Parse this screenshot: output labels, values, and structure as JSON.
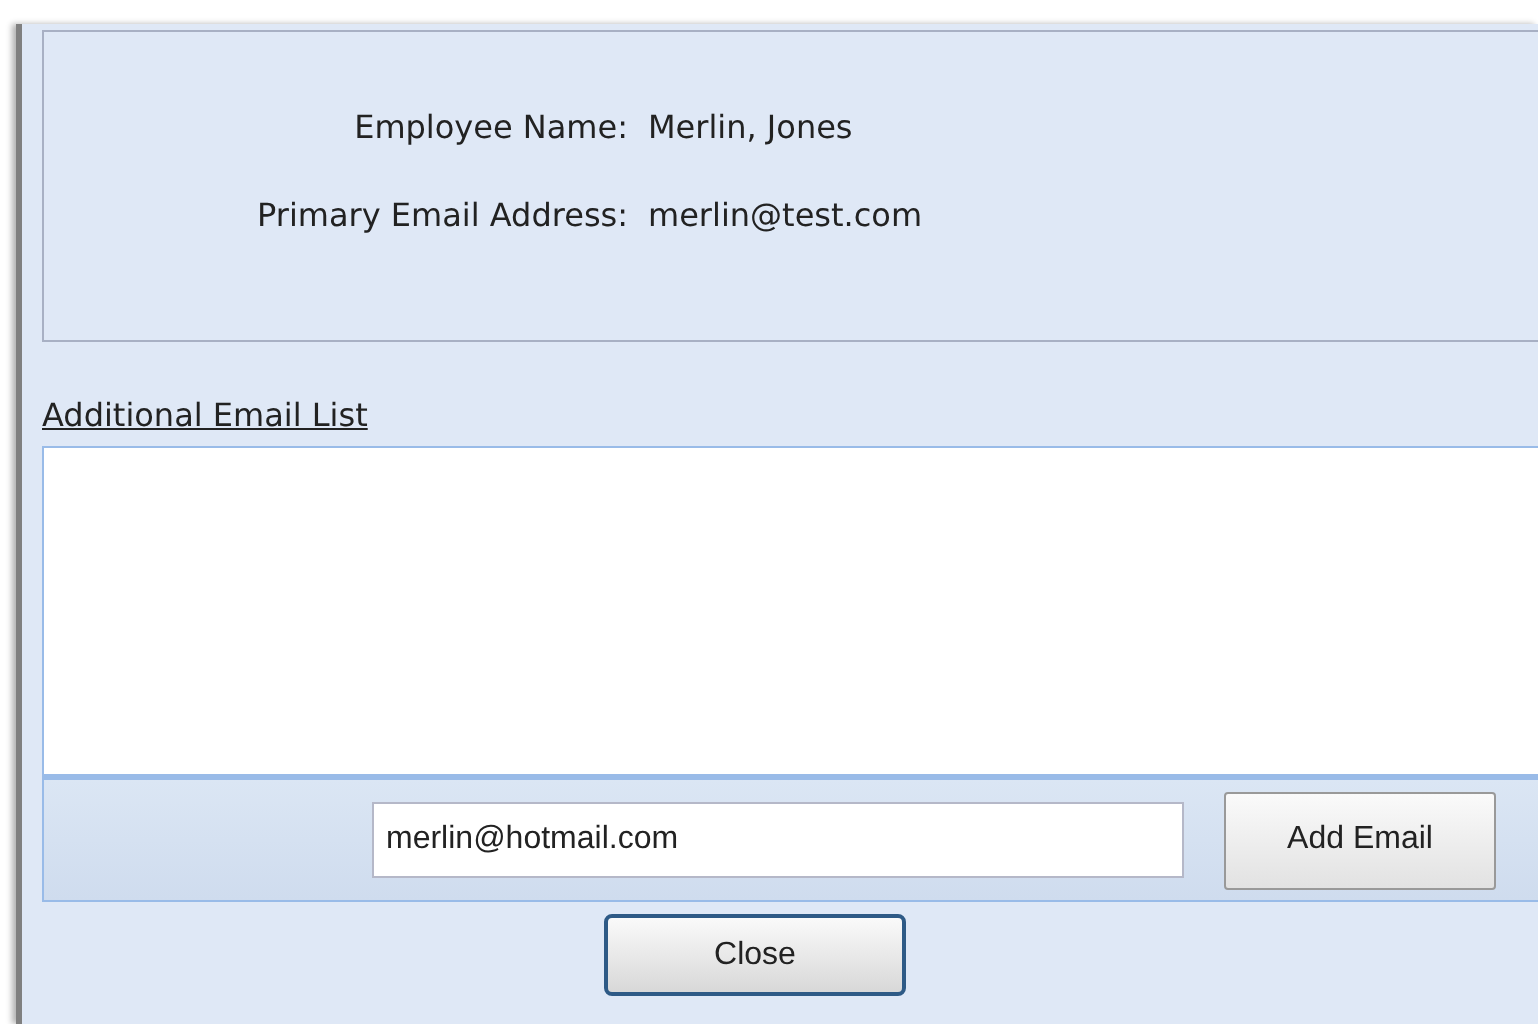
{
  "details": [
    {
      "label": "Employee Name:",
      "value": "Merlin, Jones"
    },
    {
      "label": "Primary Email Address:",
      "value": "merlin@test.com"
    }
  ],
  "list_title": "Additional Email List",
  "email_input": {
    "value": "merlin@hotmail.com"
  },
  "add_button": "Add Email",
  "close_button": "Close"
}
